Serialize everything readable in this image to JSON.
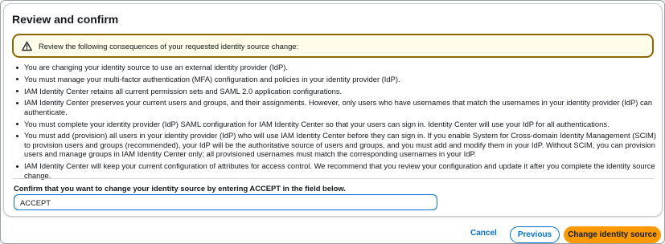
{
  "panel": {
    "title": "Review and confirm",
    "alert": {
      "icon": "warning-icon",
      "text": "Review the following consequences of your requested identity source change:"
    },
    "consequences": [
      "You are changing your identity source to use an external identity provider (IdP).",
      "You must manage your multi-factor authentication (MFA) configuration and policies in your identity provider (IdP).",
      "IAM Identity Center retains all current permission sets and SAML 2.0 application configurations.",
      "IAM Identity Center preserves your current users and groups, and their assignments. However, only users who have usernames that match the usernames in your identity provider (IdP) can authenticate.",
      "You must complete your identity provider (IdP) SAML configuration for IAM Identity Center so that your users can sign in. Identity Center will use your IdP for all authentications.",
      "You must add (provision) all users in your identity provider (IdP) who will use IAM Identity Center before they can sign in. If you enable System for Cross-domain Identity Management (SCIM) to provision users and groups (recommended), your IdP will be the authoritative source of users and groups, and you must add and modify them in your IdP. Without SCIM, you can provision users and manage groups in IAM Identity Center only; all provisioned usernames must match the corresponding usernames in your IdP.",
      "IAM Identity Center will keep your current configuration of attributes for access control. We recommend that you review your configuration and update it after you complete the identity source change."
    ],
    "confirm": {
      "label": "Confirm that you want to change your identity source by entering ACCEPT in the field below.",
      "value": "ACCEPT"
    }
  },
  "footer": {
    "cancel_label": "Cancel",
    "previous_label": "Previous",
    "primary_label": "Change identity source"
  },
  "colors": {
    "link": "#0972d3",
    "primary": "#ff9900",
    "alert_border": "#8d6605",
    "alert_bg": "#fffce9"
  }
}
